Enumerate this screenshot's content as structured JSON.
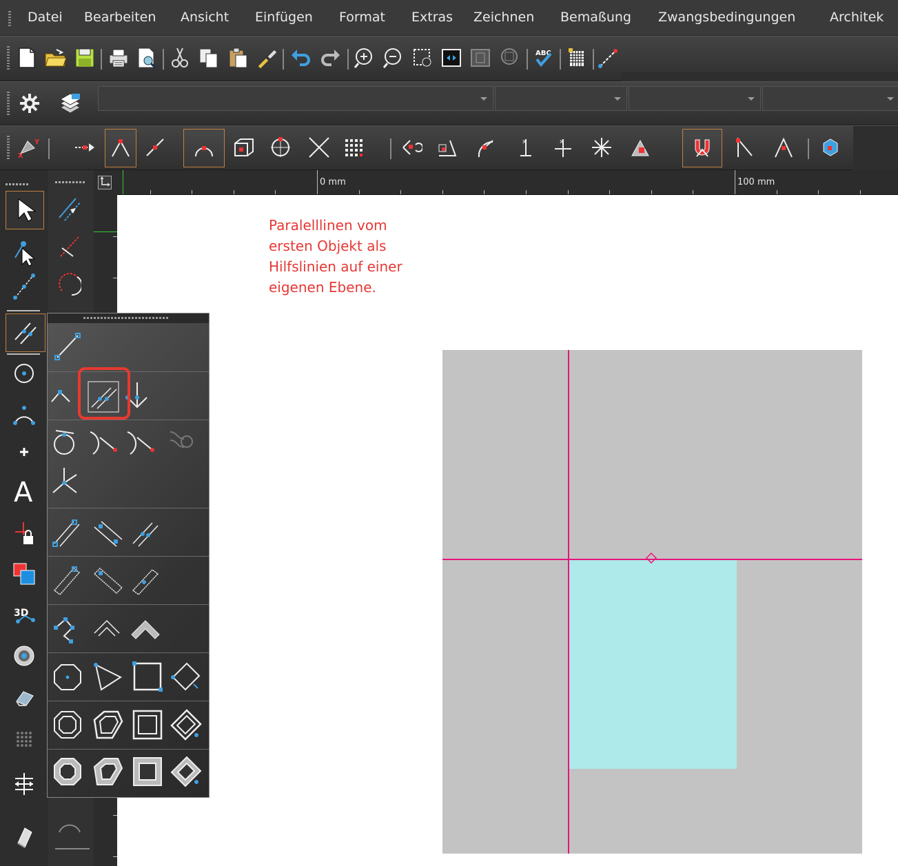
{
  "menubar": {
    "items": [
      "Datei",
      "Bearbeiten",
      "Ansicht",
      "Einfügen",
      "Format",
      "Extras",
      "Zeichnen",
      "Bemaßung",
      "Zwangsbedingungen",
      "Architek"
    ]
  },
  "ruler": {
    "label_left": "0 mm",
    "label_right": "100 mm"
  },
  "canvas": {
    "note_text": "Paralelllinen vom\nersten Objekt als\nHilfslinien auf einer\neigenen Ebene.",
    "note_color": "#e53935",
    "rect_gray_color": "#c3c3c3",
    "rect_cyan_color": "#aeeaea",
    "guide_color": "#e8157a"
  },
  "flyout": {
    "highlight_color": "#e8392f",
    "highlighted_tool": "parallel-line-icon"
  },
  "colors": {
    "ui_dark": "#2d2d2d",
    "ui_accent_blue": "#3fa0e0"
  }
}
